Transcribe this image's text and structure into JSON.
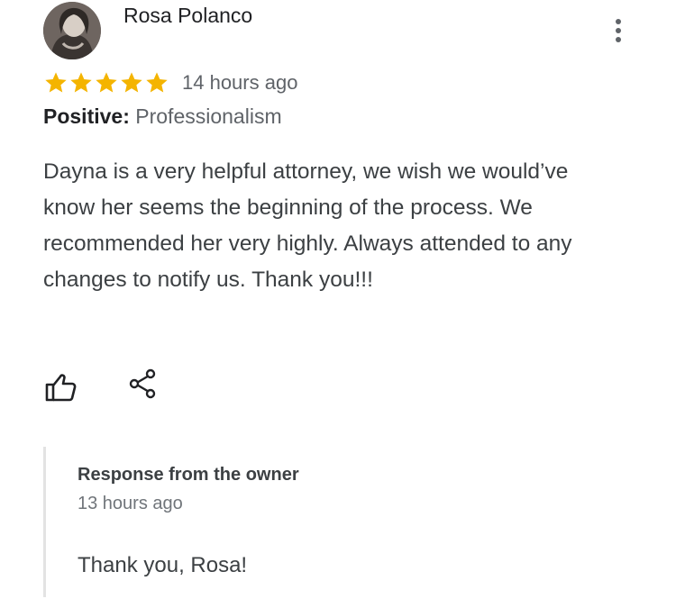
{
  "review": {
    "reviewer_name": "Rosa Polanco",
    "rating": 5,
    "rating_max": 5,
    "time_ago": "14 hours ago",
    "highlight": {
      "label": "Positive:",
      "value": "Professionalism"
    },
    "text": "Dayna is a very helpful attorney, we wish we would’ve know her seems the beginning of the process. We recommended her very highly. Always attended to any changes to notify us. Thank you!!!"
  },
  "owner_response": {
    "title": "Response from the owner",
    "time_ago": "13 hours ago",
    "text": "Thank you, Rosa!"
  },
  "icons": {
    "avatar": "reviewer-avatar",
    "more": "more-vert-icon",
    "star": "star-icon",
    "like": "thumbs-up-icon",
    "share": "share-icon"
  },
  "colors": {
    "star": "#F4B400",
    "text_primary": "#202124",
    "text_secondary": "#5f6368",
    "reply_border": "#e3e3e3"
  }
}
